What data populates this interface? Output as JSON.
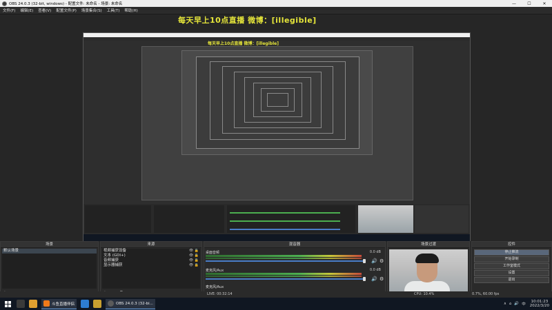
{
  "window": {
    "title": "OBS 24.0.3 (32-bit, windows) - 配置文件: 未命名 - 场景: 未命名",
    "min": "—",
    "max": "☐",
    "close": "✕"
  },
  "menu": [
    "文件(F)",
    "编辑(E)",
    "查看(V)",
    "配置文件(P)",
    "场景集合(S)",
    "工具(T)",
    "帮助(H)"
  ],
  "overlay": "每天早上10点直播  微博：[illegible]",
  "overlay_inner": "每天早上10点直播  微博：[illegible]",
  "scenes": {
    "header": "场景",
    "items": [
      "默认场景"
    ],
    "foot": [
      "+",
      "−",
      "∧",
      "∨"
    ]
  },
  "sources": {
    "header": "来源",
    "items": [
      "视频捕获设备",
      "文本 (GDI+)",
      "音频捕获",
      "显示器捕获"
    ],
    "foot": [
      "+",
      "−",
      "⚙",
      "∧",
      "∨"
    ]
  },
  "mixer": {
    "header": "混音器",
    "items": [
      {
        "name": "桌面音频",
        "db": "0.0 dB"
      },
      {
        "name": "麦克风/Aux",
        "db": "0.0 dB"
      }
    ],
    "third": "麦克风/Aux"
  },
  "transitions": {
    "header": "场景过渡"
  },
  "controls": {
    "header": "控件",
    "buttons": [
      "停止推流",
      "开始录制",
      "工作室模式",
      "设置",
      "退出"
    ]
  },
  "status": {
    "left": "0.7%, 60.00 fps",
    "time": "LIVE: 00:32:14",
    "right": "CPU: 10.4%"
  },
  "taskbar": {
    "apps": [
      {
        "label": "斗鱼直播伴侣",
        "color": "#f07a1a"
      },
      {
        "label": "OBS 24.0.3 (32-bi...",
        "color": "#5b5b5b"
      }
    ],
    "clock_time": "10:01:23",
    "clock_date": "2022/3/20"
  }
}
